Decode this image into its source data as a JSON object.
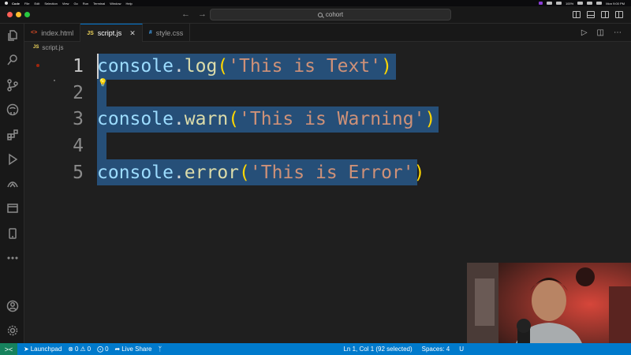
{
  "menubar": {
    "app": "Code",
    "items": [
      "File",
      "Edit",
      "Selection",
      "View",
      "Go",
      "Run",
      "Terminal",
      "Window",
      "Help"
    ],
    "battery": "100%",
    "clock": "Mon 9:00 PM"
  },
  "titlebar": {
    "search_text": "cohort"
  },
  "tabs": [
    {
      "icon": "<>",
      "label": "index.html"
    },
    {
      "icon": "JS",
      "label": "script.js"
    },
    {
      "icon": "#",
      "label": "style.css"
    }
  ],
  "breadcrumb": {
    "icon": "JS",
    "file": "script.js"
  },
  "editor": {
    "line_numbers": [
      "1",
      "2",
      "3",
      "4",
      "5"
    ],
    "lines": [
      {
        "obj": "console",
        "dot": ".",
        "fn": "log",
        "open": "(",
        "str": "'This is Text'",
        "close": ")"
      },
      {
        "obj": "console",
        "dot": ".",
        "fn": "warn",
        "open": "(",
        "str": "'This is Warning'",
        "close": ")"
      },
      {
        "obj": "console",
        "dot": ".",
        "fn": "error",
        "open": "(",
        "str": "'This is Error'",
        "close": ")"
      }
    ]
  },
  "status": {
    "remote": "><",
    "launchpad": "Launchpad",
    "errors": "0",
    "warnings": "0",
    "ports": "0",
    "live_share": "Live Share",
    "cursor_pos": "Ln 1, Col 1 (92 selected)",
    "spaces": "Spaces: 4",
    "encoding": "U"
  },
  "colors": {
    "accent": "#007acc",
    "selection": "#264f78",
    "editor_bg": "#1f1f1f"
  }
}
